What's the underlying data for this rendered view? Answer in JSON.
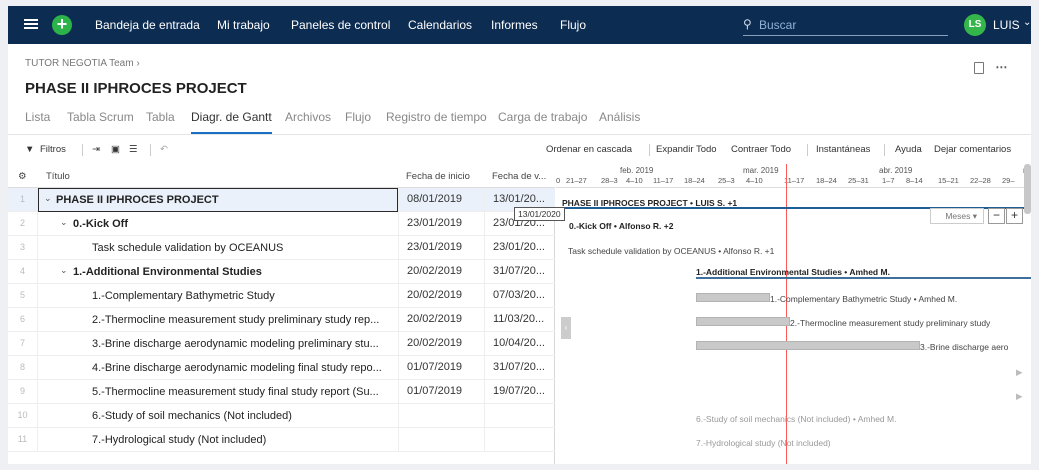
{
  "topbar": {
    "nav": [
      "Bandeja de entrada",
      "Mi trabajo",
      "Paneles de control",
      "Calendarios",
      "Informes",
      "Flujo"
    ],
    "search_placeholder": "Buscar",
    "avatar_initials": "LS",
    "user_name": "LUIS"
  },
  "breadcrumb": "TUTOR NEGOTIA Team",
  "page_title": "PHASE II IPHROCES PROJECT",
  "tabs": [
    "Lista",
    "Tabla Scrum",
    "Tabla",
    "Diagr. de Gantt",
    "Archivos",
    "Flujo",
    "Registro de tiempo",
    "Carga de trabajo",
    "Análisis"
  ],
  "active_tab": "Diagr. de Gantt",
  "toolbar": {
    "filters": "Filtros",
    "cascade_order": "Ordenar en cascada",
    "expand_all": "Expandir Todo",
    "collapse_all": "Contraer Todo",
    "snapshots": "Instantáneas",
    "help": "Ayuda",
    "feedback": "Dejar comentarios"
  },
  "table": {
    "headers": {
      "title": "Título",
      "start": "Fecha de inicio",
      "end": "Fecha de v..."
    },
    "rows": [
      {
        "num": "1",
        "title": "PHASE II IPHROCES PROJECT",
        "start": "08/01/2019",
        "end": "13/01/20..."
      },
      {
        "num": "2",
        "title": "0.-Kick Off",
        "start": "23/01/2019",
        "end": "23/01/20..."
      },
      {
        "num": "3",
        "title": "Task schedule validation by OCEANUS",
        "start": "23/01/2019",
        "end": "23/01/20..."
      },
      {
        "num": "4",
        "title": "1.-Additional Environmental Studies",
        "start": "20/02/2019",
        "end": "31/07/20..."
      },
      {
        "num": "5",
        "title": "1.-Complementary Bathymetric Study",
        "start": "20/02/2019",
        "end": "07/03/20..."
      },
      {
        "num": "6",
        "title": "2.-Thermocline measurement study preliminary study rep...",
        "start": "20/02/2019",
        "end": "11/03/20..."
      },
      {
        "num": "7",
        "title": "3.-Brine discharge aerodynamic modeling preliminary stu...",
        "start": "20/02/2019",
        "end": "10/04/20..."
      },
      {
        "num": "8",
        "title": "4.-Brine discharge aerodynamic modeling final study repo...",
        "start": "01/07/2019",
        "end": "31/07/20..."
      },
      {
        "num": "9",
        "title": "5.-Thermocline measurement study final study report (Su...",
        "start": "01/07/2019",
        "end": "19/07/20..."
      },
      {
        "num": "10",
        "title": "6.-Study of soil mechanics (Not included)",
        "start": "",
        "end": ""
      },
      {
        "num": "11",
        "title": "7.-Hydrological study (Not included)",
        "start": "",
        "end": ""
      }
    ]
  },
  "gantt": {
    "months": [
      "feb. 2019",
      "mar. 2019",
      "abr. 2019",
      "m"
    ],
    "weeks": [
      "0",
      "21–27",
      "28–3",
      "4–10",
      "11–17",
      "18–24",
      "25–3",
      "4–10",
      "11–17",
      "18–24",
      "25–31",
      "1–7",
      "8–14",
      "15–21",
      "22–28",
      "29–"
    ],
    "tooltip": "13/01/2020",
    "zoom_label": "Meses",
    "labels": {
      "project": "PHASE II IPHROCES PROJECT • LUIS S. +1",
      "kickoff": "0.-Kick Off • Alfonso R. +2",
      "validation": "Task schedule validation by OCEANUS • Alfonso R. +1",
      "additional": "1.-Additional Environmental Studies • Amhed M.",
      "bathymetric": "1.-Complementary Bathymetric Study • Amhed M.",
      "thermo": "2.-Thermocline measurement study preliminary study",
      "brine": "3.-Brine discharge aero",
      "soil": "6.-Study of soil mechanics  (Not included) • Amhed M.",
      "hydro": "7.-Hydrological study  (Not included)"
    }
  }
}
